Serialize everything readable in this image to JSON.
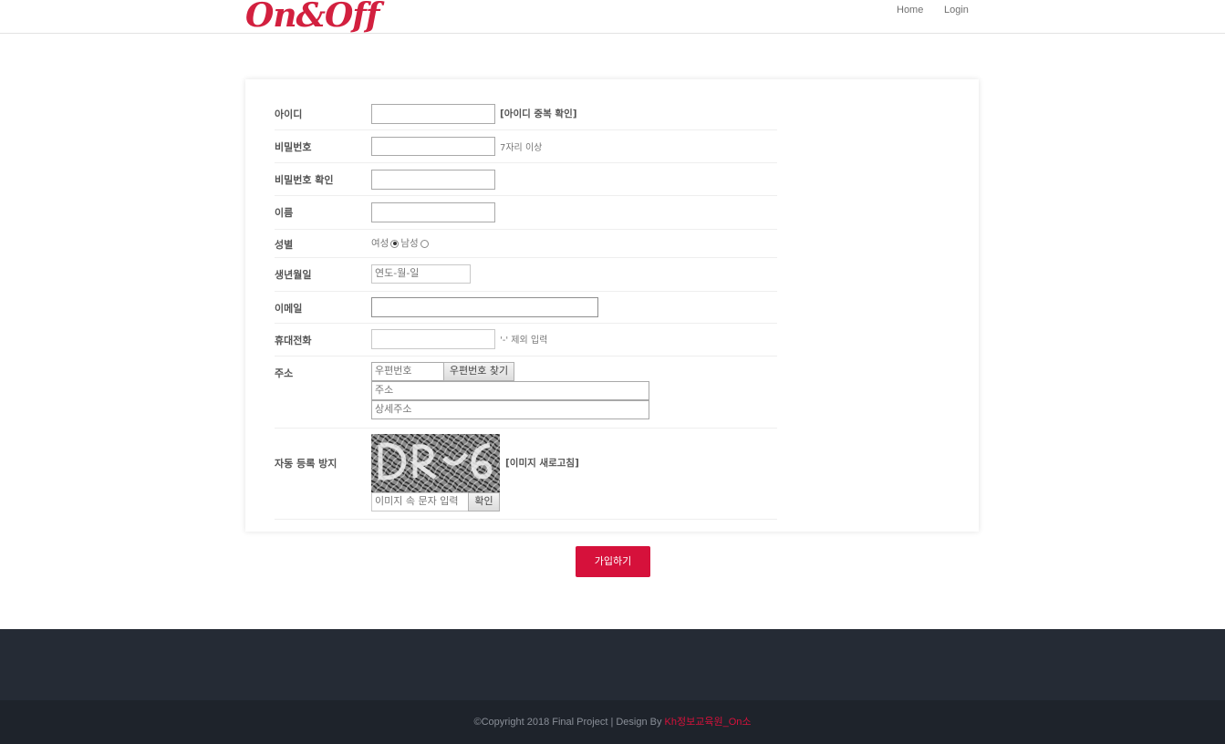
{
  "header": {
    "logo": "On&Off",
    "nav": {
      "home": "Home",
      "login": "Login"
    }
  },
  "form": {
    "id": {
      "label": "아이디",
      "value": "",
      "check_label": "[아이디 중복 확인]"
    },
    "password": {
      "label": "비밀번호",
      "value": "",
      "hint": "7자리 이상"
    },
    "password_confirm": {
      "label": "비밀번호 확인",
      "value": ""
    },
    "name": {
      "label": "이름",
      "value": ""
    },
    "gender": {
      "label": "성별",
      "female": "여성",
      "male": "남성",
      "selected": "여성"
    },
    "birthdate": {
      "label": "생년월일",
      "placeholder": "연도-월-일"
    },
    "email": {
      "label": "이메일",
      "value": ""
    },
    "phone": {
      "label": "휴대전화",
      "value": "",
      "hint": "'-' 제외 입력"
    },
    "address": {
      "label": "주소",
      "zip_placeholder": "우편번호",
      "find_button": "우편번호 찾기",
      "address_placeholder": "주소",
      "detail_placeholder": "상세주소"
    },
    "captcha": {
      "label": "자동 등록 방지",
      "refresh_label": "[이미지 새로고침]",
      "input_placeholder": "이미지 속 문자 입력",
      "confirm_button": "확인"
    },
    "submit_label": "가입하기"
  },
  "footer": {
    "copyright": "©Copyright 2018 Final Project | Design By ",
    "credit": "Kh정보교육원_On소"
  },
  "colors": {
    "accent": "#d6113b",
    "footer_top": "#252b35",
    "footer_bottom": "#1e232b"
  }
}
